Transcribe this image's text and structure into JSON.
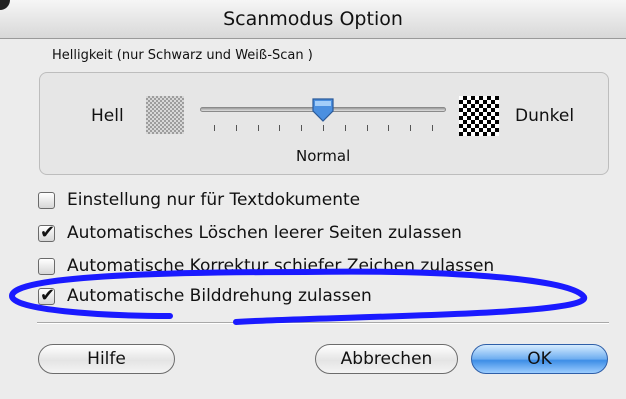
{
  "window": {
    "title": "Scanmodus Option"
  },
  "brightness": {
    "group_title": "Helligkeit (nur Schwarz und Weiß-Scan )",
    "left_label": "Hell",
    "right_label": "Dunkel",
    "current_value_label": "Normal",
    "slider_level_fraction": 0.5,
    "tick_count": 11
  },
  "options": [
    {
      "label": "Einstellung nur für Textdokumente",
      "checked": false
    },
    {
      "label": "Automatisches Löschen leerer Seiten zulassen",
      "checked": true
    },
    {
      "label": "Automatische Korrektur schiefer Zeichen zulassen",
      "checked": false
    },
    {
      "label": "Automatische Bilddrehung zulassen",
      "checked": true
    }
  ],
  "buttons": {
    "help": "Hilfe",
    "cancel": "Abbrechen",
    "ok": "OK"
  },
  "colors": {
    "annotation_ellipse": "#1a1aff",
    "slider_thumb": "#4a8fe0",
    "default_button": "#3d8de6"
  },
  "icons": {
    "checkmark": "check-icon"
  }
}
